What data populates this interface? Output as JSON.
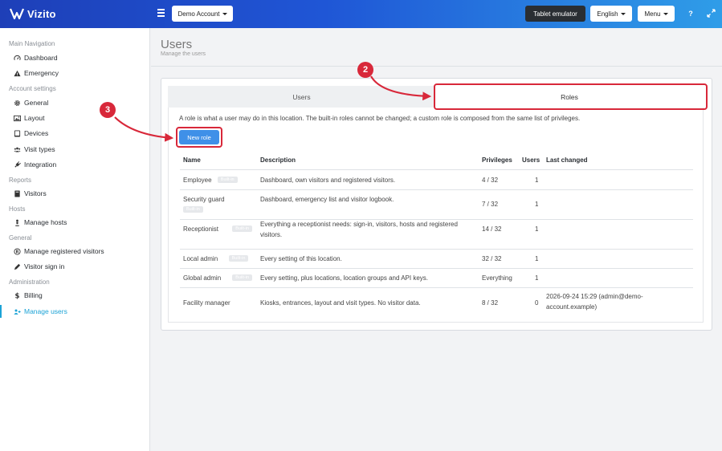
{
  "brand": {
    "name": "Vizito"
  },
  "topbar": {
    "account": "Demo Account",
    "tablet_emulator": "Tablet emulator",
    "language": "English",
    "menu": "Menu",
    "help_icon": "question-icon",
    "expand_icon": "expand-icon"
  },
  "sidebar": {
    "sections": [
      {
        "heading": "Main Navigation",
        "items": [
          {
            "label": "Dashboard",
            "icon": "gauge-icon"
          },
          {
            "label": "Emergency",
            "icon": "warning-icon"
          }
        ]
      },
      {
        "heading": "Account settings",
        "items": [
          {
            "label": "General",
            "icon": "gear-icon"
          },
          {
            "label": "Layout",
            "icon": "image-icon"
          },
          {
            "label": "Devices",
            "icon": "tablet-icon"
          },
          {
            "label": "Visit types",
            "icon": "users-icon"
          },
          {
            "label": "Integration",
            "icon": "plug-icon"
          }
        ]
      },
      {
        "heading": "Reports",
        "items": [
          {
            "label": "Visitors",
            "icon": "book-icon"
          }
        ]
      },
      {
        "heading": "Hosts",
        "items": [
          {
            "label": "Manage hosts",
            "icon": "person-icon"
          }
        ]
      },
      {
        "heading": "General",
        "items": [
          {
            "label": "Manage registered visitors",
            "icon": "registered-icon"
          },
          {
            "label": "Visitor sign in",
            "icon": "pen-icon"
          }
        ]
      },
      {
        "heading": "Administration",
        "items": [
          {
            "label": "Billing",
            "icon": "dollar-icon"
          },
          {
            "label": "Manage users",
            "icon": "user-plus-icon",
            "active": true
          }
        ]
      }
    ]
  },
  "page": {
    "title": "Users",
    "subtitle": "Manage the users"
  },
  "tabs": [
    {
      "label": "Users"
    },
    {
      "label": "Roles",
      "selected": true
    }
  ],
  "roles_panel": {
    "info": "A role is what a user may do in this location. The built-in roles cannot be changed; a custom role is composed from the same list of privileges.",
    "new_role": "New role",
    "columns": [
      "Name",
      "Description",
      "Privileges",
      "Users",
      "Last changed"
    ],
    "rows": [
      {
        "name": "Employee",
        "badge": "Built-in",
        "description": "Dashboard, own visitors and registered visitors.",
        "privileges": "4 / 32",
        "users": "1",
        "last_changed": ""
      },
      {
        "name": "Security guard",
        "badge": "Built-in",
        "description": "Dashboard, emergency list and visitor logbook.",
        "privileges": "7 / 32",
        "users": "1",
        "last_changed": ""
      },
      {
        "name": "Receptionist",
        "badge": "Built-in",
        "description": "Everything a receptionist needs: sign-in, visitors, hosts and registered visitors.",
        "privileges": "14 / 32",
        "users": "1",
        "last_changed": ""
      },
      {
        "name": "Local admin",
        "badge": "Built-in",
        "description": "Every setting of this location.",
        "privileges": "32 / 32",
        "users": "1",
        "last_changed": ""
      },
      {
        "name": "Global admin",
        "badge": "Built-in",
        "description": "Every setting, plus locations, location groups and API keys.",
        "privileges": "Everything",
        "users": "1",
        "last_changed": ""
      },
      {
        "name": "Facility manager",
        "badge": "",
        "description": "Kiosks, entrances, layout and visit types. No visitor data.",
        "privileges": "8 / 32",
        "users": "0",
        "last_changed": "2026-09-24 15:29 (admin@demo-account.example)"
      }
    ]
  },
  "callouts": [
    {
      "number": "2"
    },
    {
      "number": "3"
    }
  ],
  "colors": {
    "accent": "#1ca3d6",
    "callout": "#d8283a",
    "button": "#3f90e8",
    "topbar_start": "#1e3fb8",
    "topbar_end": "#2f9de8"
  }
}
